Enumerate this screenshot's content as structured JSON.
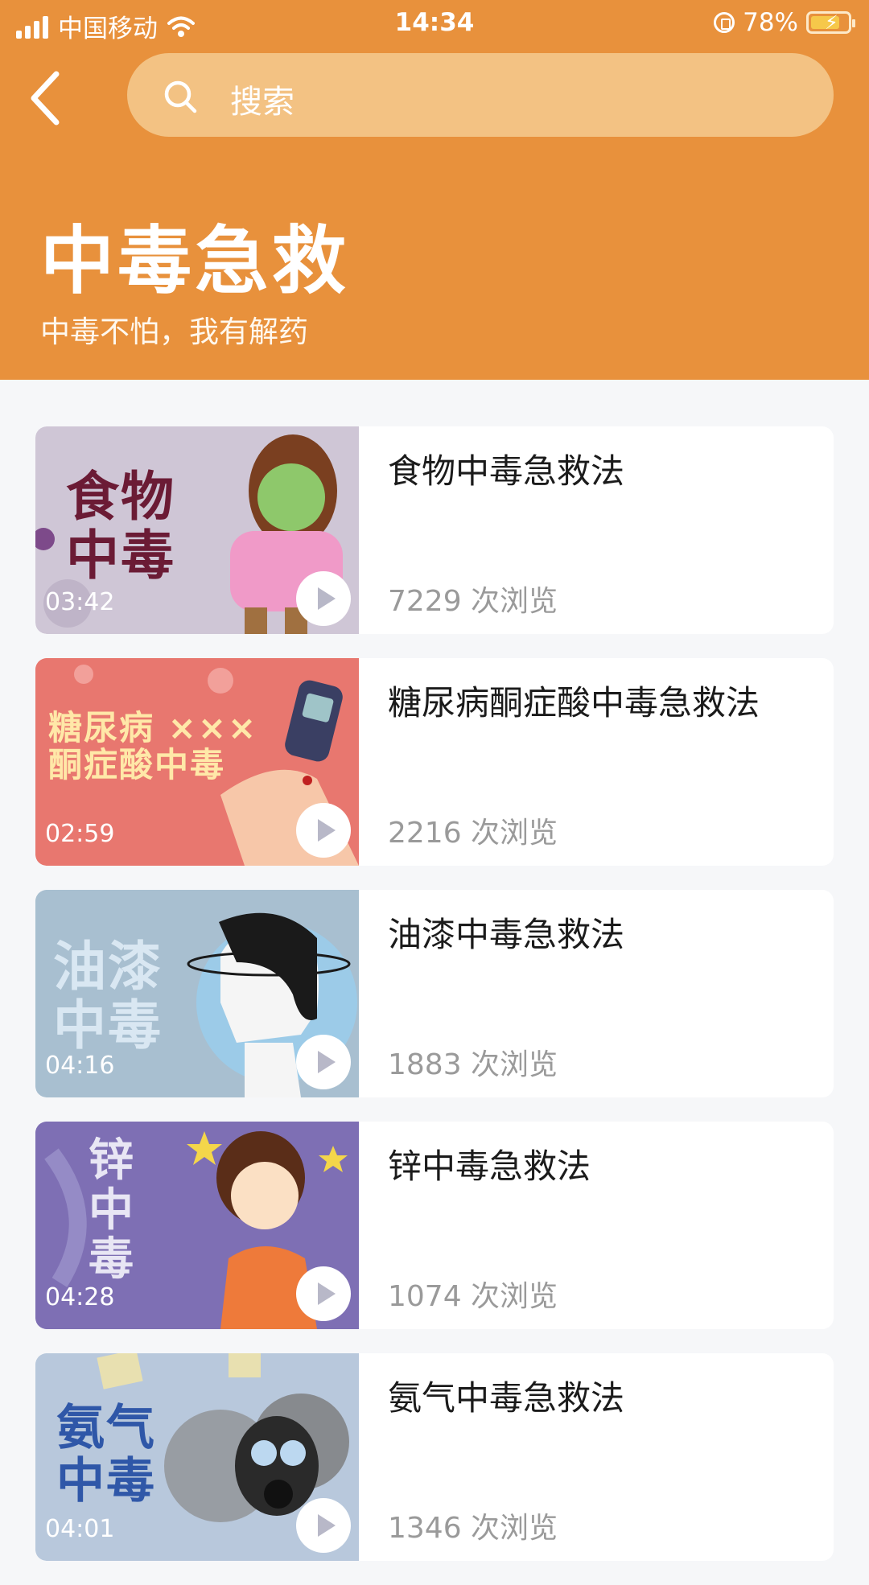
{
  "status_bar": {
    "carrier": "中国移动",
    "time": "14:34",
    "battery": "78%"
  },
  "header": {
    "search_placeholder": "搜索",
    "title": "中毒急救",
    "subtitle": "中毒不怕，我有解药"
  },
  "items": [
    {
      "title": "食物中毒急救法",
      "views": "7229 次浏览",
      "duration": "03:42",
      "thumb_text": "食物\n中毒",
      "thumb_bg": "#cfc6d6",
      "thumb_text_color": "#6b1b35"
    },
    {
      "title": "糖尿病酮症酸中毒急救法",
      "views": "2216 次浏览",
      "duration": "02:59",
      "thumb_text": "糖尿病 ×××\n酮症酸中毒",
      "thumb_bg": "#e8776f",
      "thumb_text_color": "#ffe8a8"
    },
    {
      "title": "油漆中毒急救法",
      "views": "1883 次浏览",
      "duration": "04:16",
      "thumb_text": "油漆\n中毒",
      "thumb_bg": "#a8bfd0",
      "thumb_text_color": "#d9e7f2"
    },
    {
      "title": "锌中毒急救法",
      "views": "1074 次浏览",
      "duration": "04:28",
      "thumb_text": "锌\n中\n毒",
      "thumb_bg": "#7e6fb4",
      "thumb_text_color": "#e8e6f4"
    },
    {
      "title": "氨气中毒急救法",
      "views": "1346 次浏览",
      "duration": "04:01",
      "thumb_text": "氨气\n中毒",
      "thumb_bg": "#b8c8dc",
      "thumb_text_color": "#2f57a8"
    }
  ]
}
